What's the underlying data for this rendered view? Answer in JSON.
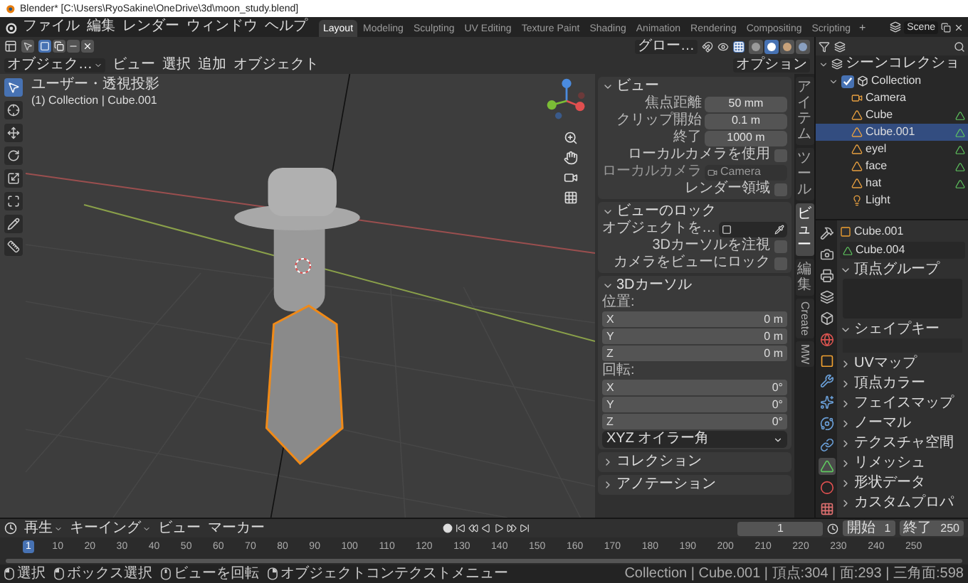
{
  "window": {
    "title": "Blender* [C:\\Users\\RyoSakine\\OneDrive\\3d\\moon_study.blend]"
  },
  "menu": [
    "ファイル",
    "編集",
    "レンダー",
    "ウィンドウ",
    "ヘルプ"
  ],
  "workspaces": [
    {
      "label": "Layout",
      "selected": true
    },
    {
      "label": "Modeling",
      "selected": false
    },
    {
      "label": "Sculpting",
      "selected": false
    },
    {
      "label": "UV Editing",
      "selected": false
    },
    {
      "label": "Texture Paint",
      "selected": false
    },
    {
      "label": "Shading",
      "selected": false
    },
    {
      "label": "Animation",
      "selected": false
    },
    {
      "label": "Rendering",
      "selected": false
    },
    {
      "label": "Compositing",
      "selected": false
    },
    {
      "label": "Scripting",
      "selected": false
    }
  ],
  "add_workspace": "+",
  "scene": {
    "name": "Scene"
  },
  "viewport": {
    "select_modes": [
      {
        "kind": "new",
        "selected": true
      },
      {
        "kind": "extend",
        "selected": false
      },
      {
        "kind": "subtract",
        "selected": false
      },
      {
        "kind": "intersect",
        "selected": false
      }
    ],
    "orientation": "グロー…",
    "shading": [
      {
        "kind": "wireframe",
        "selected": false
      },
      {
        "kind": "solid",
        "selected": true
      },
      {
        "kind": "material",
        "selected": false
      },
      {
        "kind": "rendered",
        "selected": false
      }
    ],
    "mode": "オブジェク…",
    "menus": [
      "ビュー",
      "選択",
      "追加",
      "オブジェクト"
    ],
    "options": "オプション",
    "tools": [
      {
        "kind": "select",
        "selected": true
      },
      {
        "kind": "cursor",
        "selected": false
      },
      {
        "kind": "move",
        "selected": false
      },
      {
        "kind": "rotate",
        "selected": false
      },
      {
        "kind": "scale",
        "selected": false
      },
      {
        "kind": "transform",
        "selected": false
      },
      {
        "kind": "annotate",
        "selected": false
      },
      {
        "kind": "measure",
        "selected": false
      }
    ],
    "view_name": "ユーザー・透視投影",
    "collection_label": "(1) Collection | Cube.001"
  },
  "sidebar": {
    "panels": [
      {
        "title": "ビュー",
        "expanded": true,
        "rows": [
          {
            "kind": "field",
            "label": "焦点距離",
            "value": "50 mm"
          },
          {
            "kind": "field",
            "label": "クリップ開始",
            "value": "0.1 m"
          },
          {
            "kind": "field",
            "label": "終了",
            "value": "1000 m"
          },
          {
            "kind": "check",
            "label": "ローカルカメラを使用",
            "checked": false
          },
          {
            "kind": "object",
            "label": "ローカルカメラ",
            "value": "Camera",
            "disabled": true
          },
          {
            "kind": "check",
            "label": "レンダー領域",
            "checked": false
          }
        ]
      },
      {
        "title": "ビューのロック",
        "expanded": true,
        "rows": [
          {
            "kind": "picker",
            "label": "オブジェクトを…"
          },
          {
            "kind": "check",
            "label": "3Dカーソルを注視",
            "checked": false
          },
          {
            "kind": "check",
            "label": "カメラをビューにロック",
            "checked": false
          }
        ]
      },
      {
        "title": "3Dカーソル",
        "expanded": true,
        "rows": [
          {
            "kind": "heading",
            "label": "位置:"
          },
          {
            "kind": "axis",
            "label": "X",
            "value": "0 m"
          },
          {
            "kind": "axis",
            "label": "Y",
            "value": "0 m"
          },
          {
            "kind": "axis",
            "label": "Z",
            "value": "0 m"
          },
          {
            "kind": "heading",
            "label": "回転:"
          },
          {
            "kind": "axis",
            "label": "X",
            "value": "0°"
          },
          {
            "kind": "axis",
            "label": "Y",
            "value": "0°"
          },
          {
            "kind": "axis",
            "label": "Z",
            "value": "0°"
          },
          {
            "kind": "dropdown",
            "value": "XYZ オイラー角"
          }
        ]
      },
      {
        "title": "コレクション",
        "expanded": false
      },
      {
        "title": "アノテーション",
        "expanded": false
      }
    ],
    "tabs": [
      {
        "label": "アイテム",
        "kind": "stacked",
        "selected": false
      },
      {
        "label": "ツール",
        "kind": "stacked",
        "selected": false
      },
      {
        "label": "ビュー",
        "kind": "stacked",
        "selected": true
      },
      {
        "label": "編集",
        "kind": "stacked",
        "selected": false
      },
      {
        "label": "Create",
        "kind": "rotated",
        "selected": false
      },
      {
        "label": "MW",
        "kind": "rotated",
        "selected": false
      }
    ]
  },
  "outliner": {
    "items": [
      {
        "label": "シーンコレクショ",
        "kind": "scene",
        "selected": false,
        "children": [
          {
            "label": "Collection",
            "kind": "collection",
            "checked": true,
            "selected": false,
            "children": [
              {
                "label": "Camera",
                "kind": "camera",
                "selected": false
              },
              {
                "label": "Cube",
                "kind": "mesh",
                "selected": false
              },
              {
                "label": "Cube.001",
                "kind": "mesh",
                "selected": true
              },
              {
                "label": "eyel",
                "kind": "mesh",
                "selected": false
              },
              {
                "label": "face",
                "kind": "mesh",
                "selected": false
              },
              {
                "label": "hat",
                "kind": "mesh",
                "selected": false
              },
              {
                "label": "Light",
                "kind": "light",
                "selected": false
              }
            ]
          }
        ]
      }
    ]
  },
  "properties": {
    "object": "Cube.001",
    "mesh": "Cube.004",
    "tabs": [
      {
        "kind": "tool",
        "selected": false
      },
      {
        "kind": "render",
        "selected": false
      },
      {
        "kind": "output",
        "selected": false
      },
      {
        "kind": "view_layer",
        "selected": false
      },
      {
        "kind": "scene",
        "selected": false
      },
      {
        "kind": "world",
        "selected": false
      },
      {
        "kind": "object",
        "selected": false
      },
      {
        "kind": "modifier",
        "selected": false
      },
      {
        "kind": "particles",
        "selected": false
      },
      {
        "kind": "physics",
        "selected": false
      },
      {
        "kind": "constraint",
        "selected": false
      },
      {
        "kind": "data",
        "selected": true
      },
      {
        "kind": "material",
        "selected": false
      },
      {
        "kind": "texture",
        "selected": false
      }
    ],
    "panels": [
      {
        "title": "頂点グループ",
        "expanded": true,
        "kind": "list"
      },
      {
        "title": "シェイプキー",
        "expanded": true,
        "kind": "area"
      },
      {
        "title": "UVマップ",
        "expanded": false
      },
      {
        "title": "頂点カラー",
        "expanded": false
      },
      {
        "title": "フェイスマップ",
        "expanded": false
      },
      {
        "title": "ノーマル",
        "expanded": false
      },
      {
        "title": "テクスチャ空間",
        "expanded": false
      },
      {
        "title": "リメッシュ",
        "expanded": false
      },
      {
        "title": "形状データ",
        "expanded": false
      },
      {
        "title": "カスタムプロパ",
        "expanded": false
      }
    ]
  },
  "timeline": {
    "menus": [
      {
        "label": "再生",
        "dropdown": true
      },
      {
        "label": "キーイング",
        "dropdown": true
      },
      {
        "label": "ビュー",
        "dropdown": false
      },
      {
        "label": "マーカー",
        "dropdown": false
      }
    ],
    "current_frame": "1",
    "start": {
      "label": "開始",
      "value": "1"
    },
    "end": {
      "label": "終了",
      "value": "250"
    },
    "ruler": [
      {
        "label": "1",
        "selected": true
      },
      {
        "label": "10",
        "selected": false
      },
      {
        "label": "20",
        "selected": false
      },
      {
        "label": "30",
        "selected": false
      },
      {
        "label": "40",
        "selected": false
      },
      {
        "label": "50",
        "selected": false
      },
      {
        "label": "60",
        "selected": false
      },
      {
        "label": "70",
        "selected": false
      },
      {
        "label": "80",
        "selected": false
      },
      {
        "label": "90",
        "selected": false
      },
      {
        "label": "100",
        "selected": false
      },
      {
        "label": "110",
        "selected": false
      },
      {
        "label": "120",
        "selected": false
      },
      {
        "label": "130",
        "selected": false
      },
      {
        "label": "140",
        "selected": false
      },
      {
        "label": "150",
        "selected": false
      },
      {
        "label": "160",
        "selected": false
      },
      {
        "label": "170",
        "selected": false
      },
      {
        "label": "180",
        "selected": false
      },
      {
        "label": "190",
        "selected": false
      },
      {
        "label": "200",
        "selected": false
      },
      {
        "label": "210",
        "selected": false
      },
      {
        "label": "220",
        "selected": false
      },
      {
        "label": "230",
        "selected": false
      },
      {
        "label": "240",
        "selected": false
      },
      {
        "label": "250",
        "selected": false
      }
    ]
  },
  "status": {
    "hints": [
      {
        "kind": "left",
        "label": "選択"
      },
      {
        "kind": "left",
        "label": "ボックス選択"
      },
      {
        "kind": "middle",
        "label": "ビューを回転"
      },
      {
        "kind": "right",
        "label": "オブジェクトコンテクストメニュー"
      }
    ],
    "stats": "Collection | Cube.001 | 頂点:304 | 面:293 | 三角面:598"
  }
}
